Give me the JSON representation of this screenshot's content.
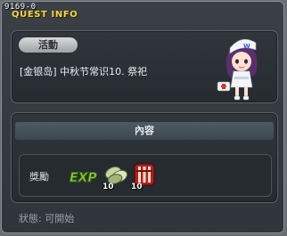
{
  "window": {
    "quest_id": "9169-0",
    "title": "QUEST INFO"
  },
  "quest": {
    "category_tag": "活動",
    "name": "[金银岛] 中秋节常识10. 祭祀"
  },
  "content": {
    "header": "內容",
    "reward_label": "獎勵",
    "rewards": [
      {
        "icon": "exp-icon",
        "label": "EXP"
      },
      {
        "icon": "songpyeon-icon",
        "count": "10"
      },
      {
        "icon": "red-item-icon",
        "count": "10"
      }
    ]
  },
  "status": {
    "text": "狀態: 可開始"
  },
  "colors": {
    "title_yellow": "#f2d54a",
    "panel_bg": "#262b30",
    "exp_green": "#8fd43a"
  }
}
